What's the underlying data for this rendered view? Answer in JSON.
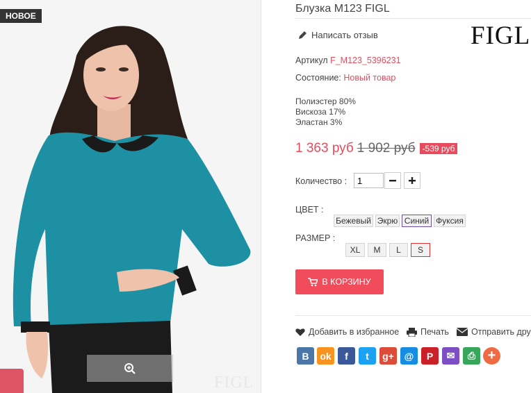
{
  "badge": "НОВОЕ",
  "watermark": "FIGL",
  "product": {
    "title": "Блузка M123 FIGL",
    "brand_logo": "FIGL",
    "write_review": "Написать отзыв",
    "sku_label": "Артикул",
    "sku": "F_M123_5396231",
    "condition_label": "Состояние:",
    "condition": "Новый товар",
    "composition": [
      "Полиэстер 80%",
      "Вискоза 17%",
      "Эластан 3%"
    ],
    "price": "1 363 руб",
    "old_price": "1 902 руб",
    "discount": "-539 руб",
    "quantity_label": "Количество :",
    "quantity": "1",
    "color_label": "ЦВЕТ :",
    "colors": [
      "Бежевый",
      "Экрю",
      "Синий",
      "Фуксия"
    ],
    "selected_color": "Синий",
    "size_label": "РАЗМЕР :",
    "sizes": [
      "XL",
      "M",
      "L",
      "S"
    ],
    "selected_size": "S",
    "cart_label": "В КОРЗИНУ"
  },
  "utilities": {
    "favorite": "Добавить в избранное",
    "print": "Печать",
    "send": "Отправить дру"
  },
  "share_buttons": [
    {
      "name": "vkontakte",
      "glyph": "B",
      "color": "#4a76a8"
    },
    {
      "name": "odnoklassniki",
      "glyph": "ok",
      "color": "#f7931e"
    },
    {
      "name": "facebook",
      "glyph": "f",
      "color": "#3b5998"
    },
    {
      "name": "twitter",
      "glyph": "t",
      "color": "#1da1f2"
    },
    {
      "name": "google-plus",
      "glyph": "g+",
      "color": "#dd4b39"
    },
    {
      "name": "mail",
      "glyph": "@",
      "color": "#168de2"
    },
    {
      "name": "pinterest",
      "glyph": "P",
      "color": "#cb2027"
    },
    {
      "name": "email",
      "glyph": "✉",
      "color": "#7d4fc4"
    },
    {
      "name": "print",
      "glyph": "⎙",
      "color": "#37a65a"
    },
    {
      "name": "more",
      "glyph": "+",
      "color": "#f06a43"
    }
  ],
  "colors": {
    "accent": "#f04c5c",
    "price": "#e74c5e",
    "dark": "#333333"
  }
}
